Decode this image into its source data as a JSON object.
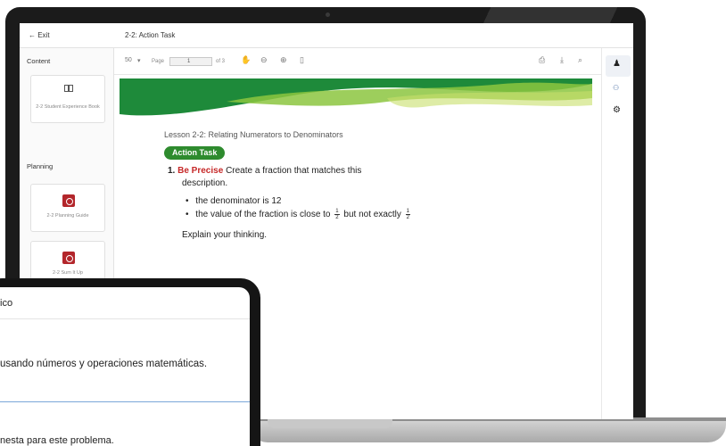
{
  "app": {
    "exit_label": "← Exit",
    "breadcrumb": "2-2: Action Task"
  },
  "sidebar": {
    "content_heading": "Content",
    "planning_heading": "Planning",
    "items": [
      {
        "label": "2-2 Student Experience Book",
        "icon": "book-icon"
      },
      {
        "label": "2-2 Planning Guide",
        "icon": "resource-icon"
      },
      {
        "label": "2-2 Sum It Up",
        "icon": "resource-icon"
      }
    ]
  },
  "toolbar": {
    "zoom_label": "50",
    "page_label": "Page",
    "page_value": "1",
    "page_of": "of 3"
  },
  "document": {
    "lesson_title": "Lesson 2-2: Relating Numerators to Denominators",
    "badge": "Action Task",
    "question_number": "1.",
    "question_keyword": "Be Precise",
    "question_text": "Create a fraction that matches this",
    "question_text_2": "description.",
    "bullet_1": "the denominator is 12",
    "bullet_2_prefix": "the value of the fraction is close to",
    "bullet_2_middle": "but not exactly",
    "frac_num": "1",
    "frac_den": "2",
    "explain": "Explain your thinking."
  },
  "tablet": {
    "title": "ico",
    "text": "usando números y operaciones matemáticas.",
    "answer_label": "nesta para este problema."
  },
  "colors": {
    "accent_green": "#2e8b2e",
    "keyword_red": "#c62828",
    "resource_red": "#b3262b",
    "bezel": "#1b1b1b"
  }
}
